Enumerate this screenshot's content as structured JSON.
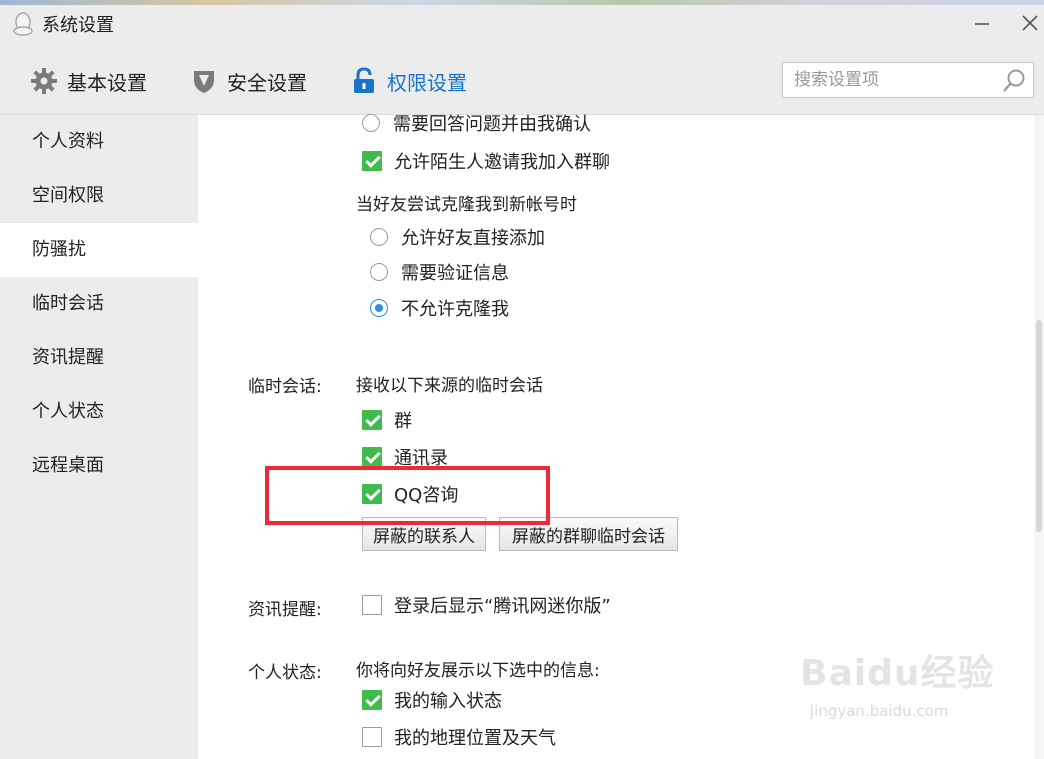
{
  "window": {
    "title": "系统设置",
    "icon": "qq-penguin-icon"
  },
  "toolbar": {
    "tabs": [
      {
        "label": "基本设置",
        "icon": "gear-icon",
        "active": false
      },
      {
        "label": "安全设置",
        "icon": "shield-icon",
        "active": false
      },
      {
        "label": "权限设置",
        "icon": "lock-icon",
        "active": true
      }
    ],
    "search": {
      "placeholder": "搜索设置项",
      "value": ""
    }
  },
  "sidebar": {
    "items": [
      {
        "label": "个人资料",
        "active": false
      },
      {
        "label": "空间权限",
        "active": false
      },
      {
        "label": "防骚扰",
        "active": true
      },
      {
        "label": "临时会话",
        "active": false
      },
      {
        "label": "资讯提醒",
        "active": false
      },
      {
        "label": "个人状态",
        "active": false
      },
      {
        "label": "远程桌面",
        "active": false
      }
    ]
  },
  "anti_harass": {
    "option_answer_confirm": "需要回答问题并由我确认",
    "option_allow_stranger_group": "允许陌生人邀请我加入群聊",
    "clone_prompt": "当好友尝试克隆我到新帐号时",
    "clone_options": [
      "允许好友直接添加",
      "需要验证信息",
      "不允许克隆我"
    ],
    "clone_selected": "不允许克隆我"
  },
  "temp_session": {
    "label": "临时会话:",
    "prompt": "接收以下来源的临时会话",
    "options": [
      {
        "label": "群",
        "checked": true
      },
      {
        "label": "通讯录",
        "checked": true
      },
      {
        "label": "QQ咨询",
        "checked": true
      }
    ],
    "buttons": {
      "block_contacts": "屏蔽的联系人",
      "block_group_temp": "屏蔽的群聊临时会话"
    }
  },
  "news_alert": {
    "label": "资讯提醒:",
    "option": {
      "label": "登录后显示“腾讯网迷你版”",
      "checked": false
    }
  },
  "personal_status": {
    "label": "个人状态:",
    "prompt": "你将向好友展示以下选中的信息:",
    "options": [
      {
        "label": "我的输入状态",
        "checked": true
      },
      {
        "label": "我的地理位置及天气",
        "checked": false
      }
    ]
  },
  "watermark": {
    "logo": "Baidu经验",
    "url": "jingyan.baidu.com"
  },
  "colors": {
    "accent": "#1a73c8",
    "check_green": "#3ebb4a",
    "highlight_red": "#ee2b34",
    "radio_blue": "#2a8fe0"
  }
}
